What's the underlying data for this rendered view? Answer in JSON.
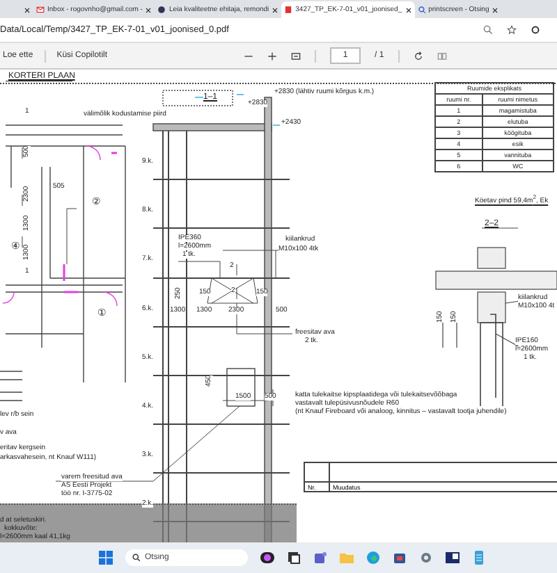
{
  "browser": {
    "tabs": [
      {
        "selected": false
      },
      {
        "title": "Inbox - rogovnho@gmail.com -",
        "selected": false
      },
      {
        "title": "Leia kvaliteetne ehitaja, remondi",
        "selected": false
      },
      {
        "title": "3427_TP_EK-7-01_v01_joonised_",
        "selected": true
      },
      {
        "title": "printscreen - Otsing",
        "selected": false
      }
    ],
    "address": "Data/Local/Temp/3427_TP_EK-7-01_v01_joonised_0.pdf",
    "pdf_toolbar": {
      "read_aloud": "Loe ette",
      "ask_copilot": "Küsi Copilotilt",
      "page": "1",
      "page_total": "/ 1"
    }
  },
  "plan": {
    "title": "KORTERI PLAAN",
    "labels": [
      "1",
      "välimõlik kodustamise piird",
      "500",
      "2300",
      "1300",
      "1300",
      "505",
      "②",
      "④",
      "1",
      "①"
    ],
    "legend": [
      "lev r/b sein",
      "v ava",
      "eritav kergsein",
      "arkasvahesein, nt Knauf W111)"
    ]
  },
  "section": {
    "title": "1–1",
    "floors": [
      "9.k.",
      "8.k.",
      "7.k.",
      "6.k.",
      "5.k.",
      "4.k.",
      "3.k.",
      "2.k."
    ],
    "labels": [
      "+2830",
      "+2830 (lähtiv ruumi kõrgus k.m.)",
      "+2430",
      "IPE360",
      "l=2600mm",
      "1 tk.",
      "kiilankrud",
      "M10x100 4tk",
      "2",
      "250",
      "150",
      "2",
      "150",
      "1300",
      "1300",
      "2300",
      "500",
      "freesitav ava",
      "2 tk.",
      "450",
      "1500",
      "500",
      "katta tulekaitse kipsplaatidega või tulekaitsevõõbaga",
      "vastavalt tulepüsivusnõudele R60",
      "(nt Knauf Fireboard või analoog, kinnitus – vastavalt tootja juhendile)",
      "varem freesitud ava",
      "AS Eesti Projekt",
      "töö nr. I-3775-02"
    ]
  },
  "notes": [
    "d at seletuskiri.",
    "kokkuvõte:",
    "l=2600mm kaal 41,1kg"
  ],
  "room_table": {
    "title": "Ruumide eksplikats",
    "columns": [
      "ruumi nr.",
      "ruumi nimetus"
    ],
    "rows": [
      [
        "1",
        "magamistuba"
      ],
      [
        "2",
        "elutuba"
      ],
      [
        "3",
        "köögituba"
      ],
      [
        "4",
        "esik"
      ],
      [
        "5",
        "vannituba"
      ],
      [
        "6",
        "WC"
      ]
    ],
    "footnote": "Köetav pind 59,4m$^{2}$, Ek"
  },
  "detail": {
    "title": "2–2",
    "labels": [
      "kiilankrud",
      "M10x100 4t",
      "IPE160",
      "l=2600mm",
      "1 tk.",
      "150",
      "150"
    ]
  },
  "revision_table": {
    "columns": [
      "Nr.",
      "Muudatus"
    ]
  },
  "taskbar": {
    "search_placeholder": "Otsing"
  }
}
